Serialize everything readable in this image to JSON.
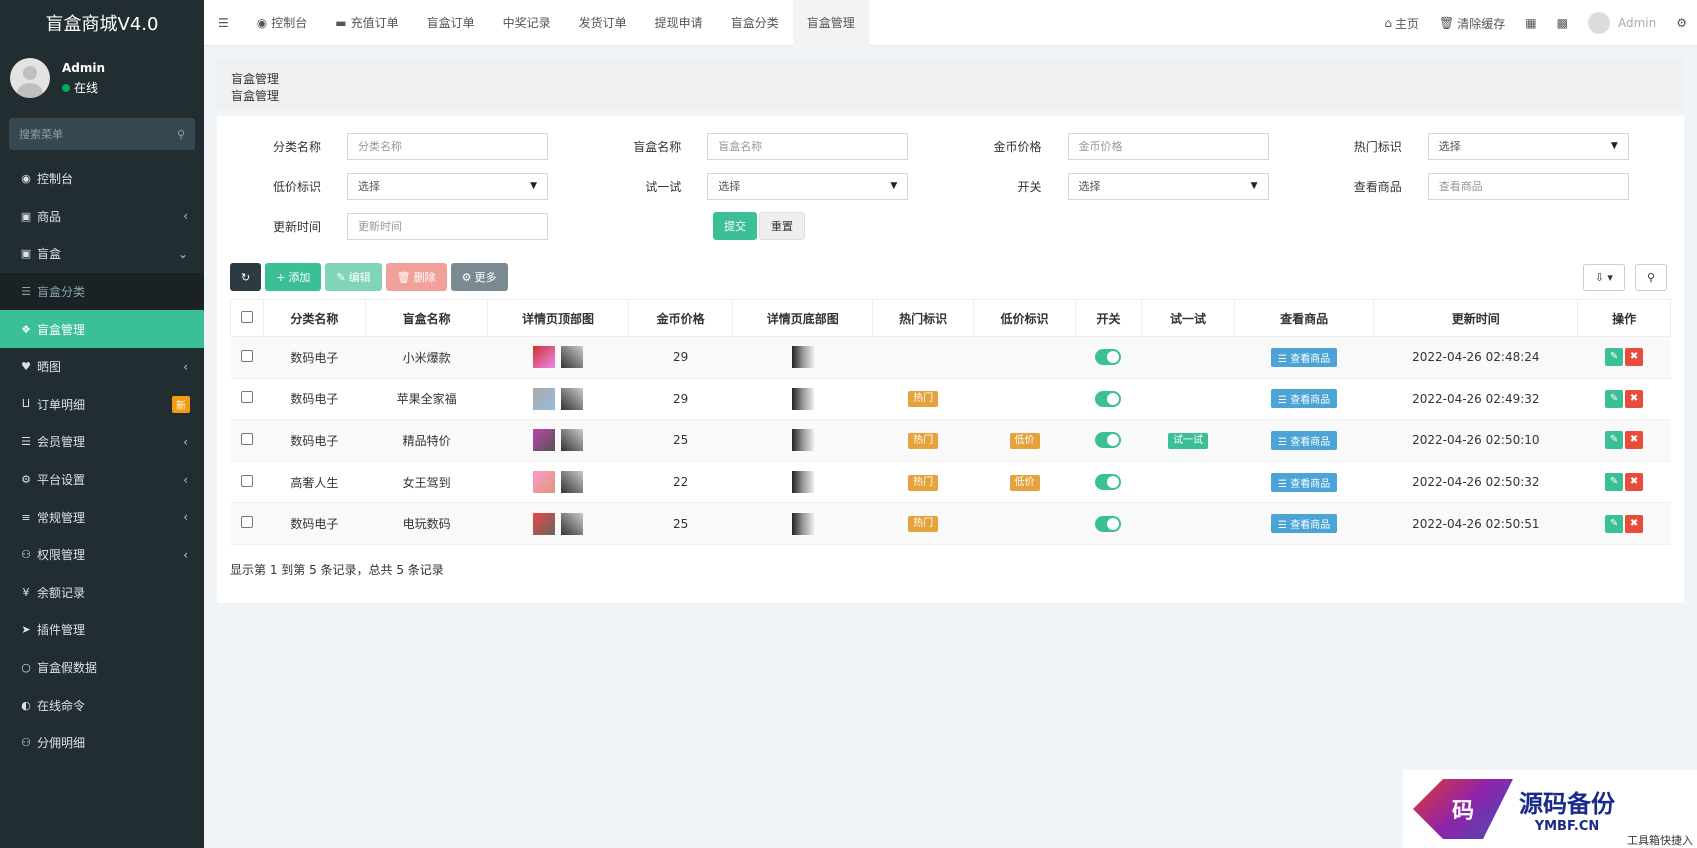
{
  "app": {
    "title": "盲盒商城V4.0"
  },
  "user": {
    "name": "Admin",
    "status": "在线"
  },
  "sidebar": {
    "search_placeholder": "搜索菜单",
    "items": [
      {
        "label": "控制台",
        "icon": "dashboard-icon"
      },
      {
        "label": "商品",
        "icon": "cube-icon"
      },
      {
        "label": "盲盒",
        "icon": "cube-icon"
      },
      {
        "label": "盲盒分类",
        "icon": "list-icon"
      },
      {
        "label": "盲盒管理",
        "icon": "cubes-icon"
      },
      {
        "label": "晒图",
        "icon": "heart-icon"
      },
      {
        "label": "订单明细",
        "icon": "cart-icon",
        "badge": "新"
      },
      {
        "label": "会员管理",
        "icon": "list-icon"
      },
      {
        "label": "平台设置",
        "icon": "gear-icon"
      },
      {
        "label": "常规管理",
        "icon": "database-icon"
      },
      {
        "label": "权限管理",
        "icon": "users-icon"
      },
      {
        "label": "余额记录",
        "icon": "yen-icon"
      },
      {
        "label": "插件管理",
        "icon": "rocket-icon"
      },
      {
        "label": "盲盒假数据",
        "icon": "circle-icon"
      },
      {
        "label": "在线命令",
        "icon": "half-circle-icon"
      },
      {
        "label": "分佣明细",
        "icon": "users-icon"
      }
    ]
  },
  "topnav": {
    "tabs": [
      "控制台",
      "充值订单",
      "盲盒订单",
      "中奖记录",
      "发货订单",
      "提现申请",
      "盲盒分类",
      "盲盒管理"
    ],
    "home": "主页",
    "clear_cache": "清除缓存",
    "user": "Admin"
  },
  "breadcrumb": {
    "title": "盲盒管理",
    "sub": "盲盒管理"
  },
  "filters": {
    "category_label": "分类名称",
    "category_ph": "分类名称",
    "name_label": "盲盒名称",
    "name_ph": "盲盒名称",
    "price_label": "金币价格",
    "price_ph": "金币价格",
    "hot_label": "热门标识",
    "hot_value": "选择",
    "low_label": "低价标识",
    "low_value": "选择",
    "try_label": "试一试",
    "try_value": "选择",
    "switch_label": "开关",
    "switch_value": "选择",
    "view_label": "查看商品",
    "view_ph": "查看商品",
    "time_label": "更新时间",
    "time_ph": "更新时间",
    "submit": "提交",
    "reset": "重置"
  },
  "toolbar": {
    "add": "添加",
    "edit": "编辑",
    "delete": "删除",
    "more": "更多"
  },
  "table": {
    "headers": [
      "分类名称",
      "盲盒名称",
      "详情页顶部图",
      "金币价格",
      "详情页底部图",
      "热门标识",
      "低价标识",
      "开关",
      "试一试",
      "查看商品",
      "更新时间",
      "操作"
    ],
    "view_btn": "查看商品",
    "rows": [
      {
        "category": "数码电子",
        "name": "小米爆款",
        "price": "29",
        "hot": "",
        "low": "",
        "try": "",
        "time": "2022-04-26 02:48:24"
      },
      {
        "category": "数码电子",
        "name": "苹果全家福",
        "price": "29",
        "hot": "热门",
        "low": "",
        "try": "",
        "time": "2022-04-26 02:49:32"
      },
      {
        "category": "数码电子",
        "name": "精品特价",
        "price": "25",
        "hot": "热门",
        "low": "低价",
        "try": "试一试",
        "time": "2022-04-26 02:50:10"
      },
      {
        "category": "高奢人生",
        "name": "女王驾到",
        "price": "22",
        "hot": "热门",
        "low": "低价",
        "try": "",
        "time": "2022-04-26 02:50:32"
      },
      {
        "category": "数码电子",
        "name": "电玩数码",
        "price": "25",
        "hot": "热门",
        "low": "",
        "try": "",
        "time": "2022-04-26 02:50:51"
      }
    ]
  },
  "footer": {
    "summary": "显示第 1 到第 5 条记录，总共 5 条记录"
  },
  "watermark": {
    "logo": "码",
    "title": "源码备份",
    "sub": "YMBF.CN",
    "extra": "工具箱快捷入"
  }
}
